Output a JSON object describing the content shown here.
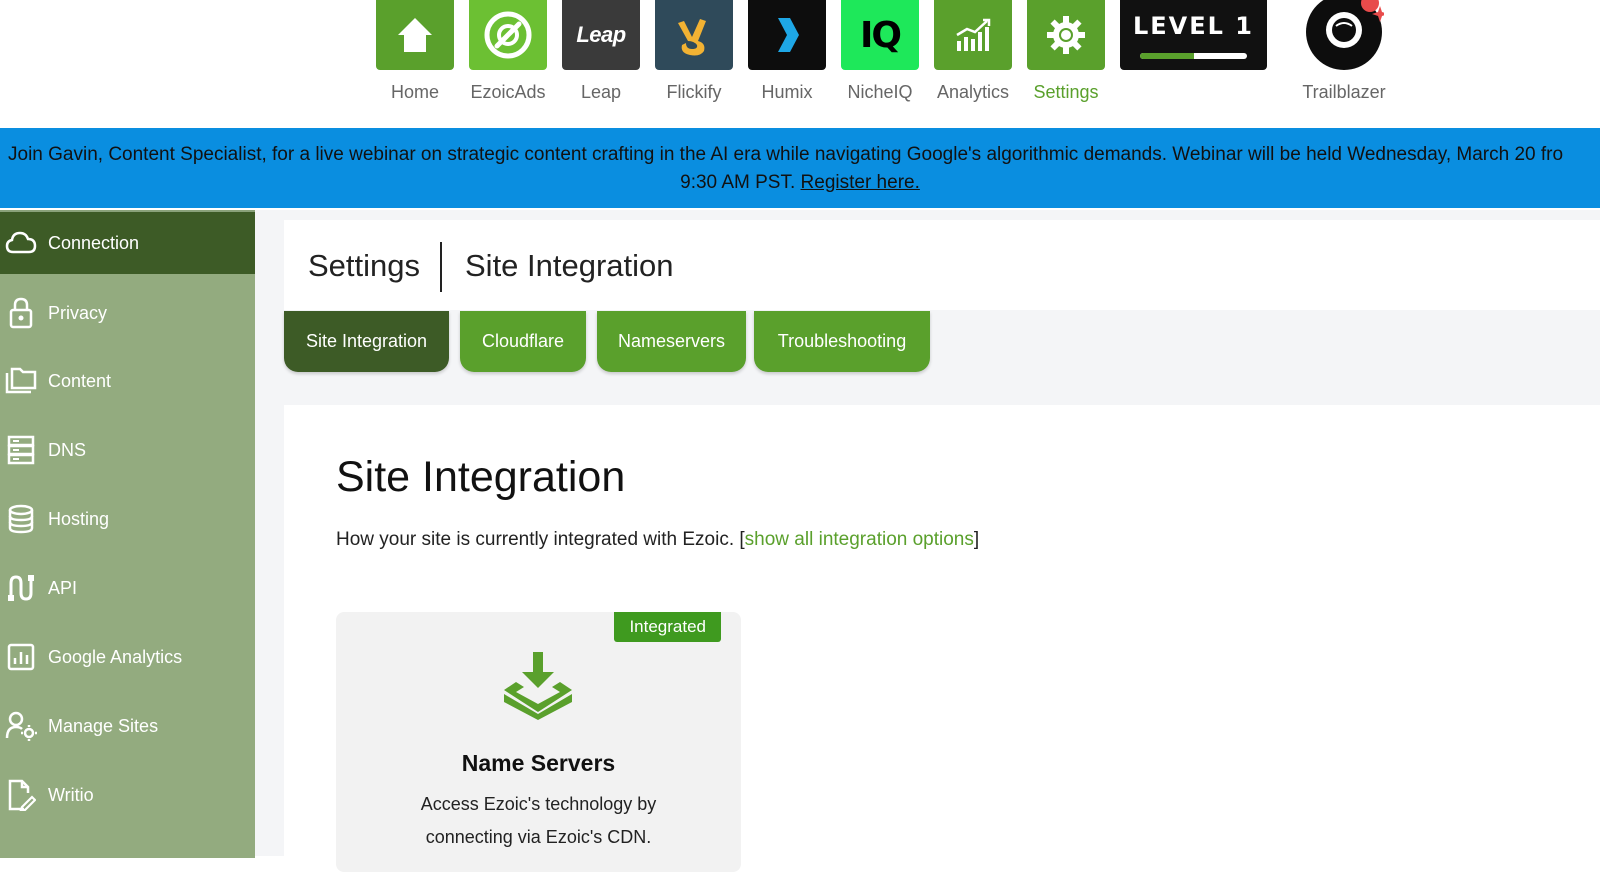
{
  "topbar": {
    "apps": [
      {
        "label": "Home",
        "color": "#5aa02c",
        "icon": "house-icon"
      },
      {
        "label": "EzoicAds",
        "color": "#6cc033",
        "icon": "ezoicads-icon"
      },
      {
        "label": "Leap",
        "color": "#3a3a3a",
        "icon": "leap-logo",
        "logo_text": "Leap"
      },
      {
        "label": "Flickify",
        "color": "#2f4a5a",
        "icon": "flickify-icon"
      },
      {
        "label": "Humix",
        "color": "#0d0d0d",
        "icon": "humix-chevron-icon"
      },
      {
        "label": "NicheIQ",
        "color": "#1ee85a",
        "icon": "nicheiq-logo",
        "logo_text": "IQ"
      },
      {
        "label": "Analytics",
        "color": "#5aa02c",
        "icon": "analytics-chart-icon"
      },
      {
        "label": "Settings",
        "color": "#5aa02c",
        "icon": "gear-icon",
        "active": true
      }
    ],
    "level": {
      "text": "LEVEL 1",
      "progress": 0.5
    },
    "avatar_label": "Trailblazer"
  },
  "banner": {
    "line1": "Join Gavin, Content Specialist, for a live webinar on strategic content crafting in the AI era while navigating Google's algorithmic demands. Webinar will be held Wednesday, March 20 fro",
    "line2_prefix": "9:30 AM PST.",
    "link_text": "Register here."
  },
  "sidebar": {
    "items": [
      {
        "label": "Connection",
        "icon": "cloud-icon",
        "active": true
      },
      {
        "label": "Privacy",
        "icon": "lock-icon"
      },
      {
        "label": "Content",
        "icon": "folders-icon"
      },
      {
        "label": "DNS",
        "icon": "server-icon"
      },
      {
        "label": "Hosting",
        "icon": "database-icon"
      },
      {
        "label": "API",
        "icon": "api-icon"
      },
      {
        "label": "Google Analytics",
        "icon": "chart-box-icon"
      },
      {
        "label": "Manage Sites",
        "icon": "user-gear-icon"
      },
      {
        "label": "Writio",
        "icon": "document-edit-icon"
      }
    ]
  },
  "header": {
    "crumb1": "Settings",
    "crumb2": "Site Integration"
  },
  "tabs": [
    {
      "label": "Site Integration",
      "active": true
    },
    {
      "label": "Cloudflare"
    },
    {
      "label": "Nameservers"
    },
    {
      "label": "Troubleshooting"
    }
  ],
  "main": {
    "title": "Site Integration",
    "description": "How your site is currently integrated with Ezoic.",
    "link_open": "[",
    "link_text": "show all integration options",
    "link_close": "]"
  },
  "card": {
    "badge": "Integrated",
    "title": "Name Servers",
    "desc_line1": "Access Ezoic's technology by",
    "desc_line2": "connecting via Ezoic's CDN."
  },
  "colors": {
    "accent": "#5aa02c",
    "dark_green": "#3d5b26",
    "sidebar": "#93ab7f",
    "banner": "#0a8ee0"
  }
}
